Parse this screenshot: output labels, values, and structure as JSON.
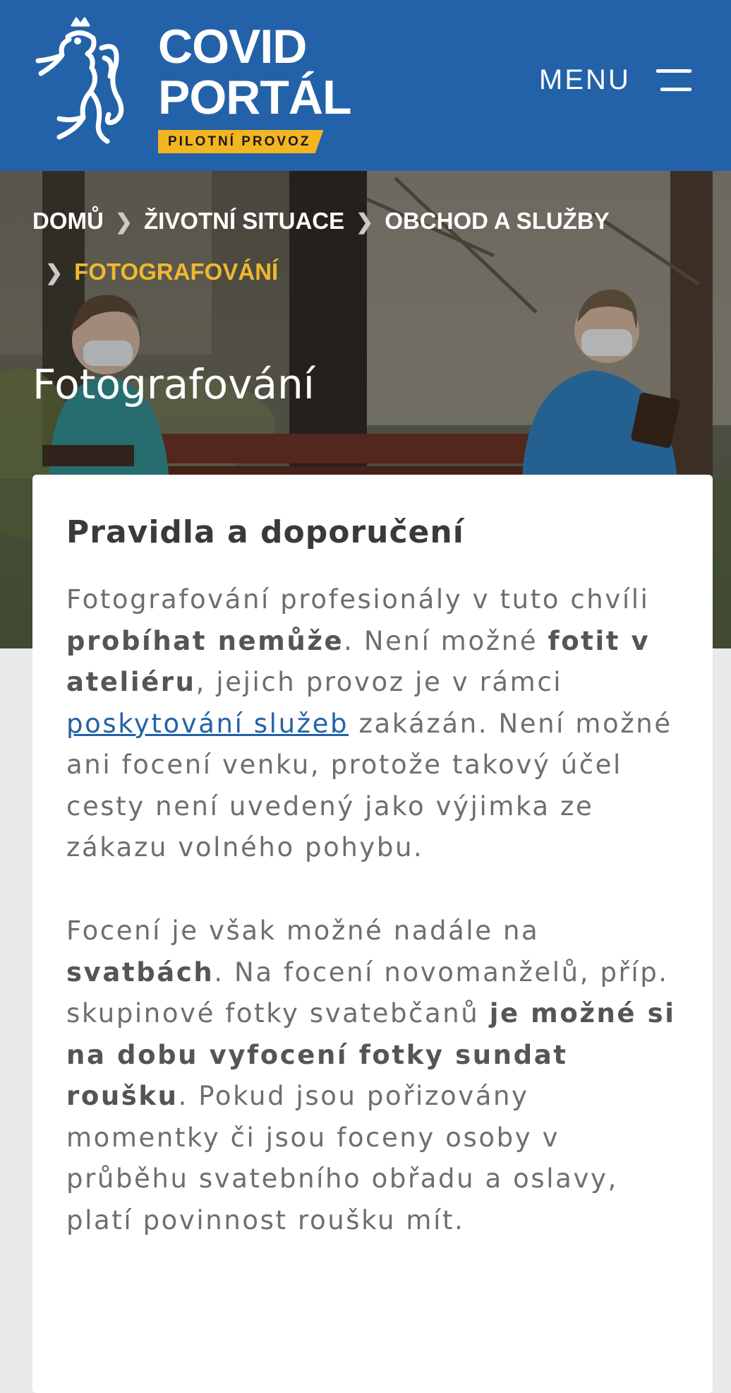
{
  "header": {
    "brand_line1": "COVID",
    "brand_line2": "PORTÁL",
    "badge": "PILOTNÍ PROVOZ",
    "menu_label": "MENU",
    "menu_icon": "hamburger-icon",
    "logo_icon": "czech-lion-emblem",
    "bg_color": "#2362a8",
    "badge_color": "#f3b520"
  },
  "breadcrumb": {
    "items": [
      "DOMŮ",
      "ŽIVOTNÍ SITUACE",
      "OBCHOD A SLUŽBY"
    ],
    "current": "FOTOGRAFOVÁNÍ",
    "separator_icon": "chevron-right-icon",
    "current_color": "#f0b82e"
  },
  "page": {
    "title": "Fotografování"
  },
  "card": {
    "heading": "Pravidla a doporučení",
    "p1": {
      "t1": "Fotografování profesionály v tuto chvíli ",
      "b1": "probíhat nemůže",
      "t2": ". Není možné ",
      "b2": "fotit v ateliéru",
      "t3": ", jejich provoz je v rámci ",
      "link": "poskytování služeb",
      "t4": " zakázán. Není možné ani focení venku, protože takový účel cesty není uvedený jako výjimka ze zákazu volného pohybu."
    },
    "p2": {
      "t1": "Focení je však možné nadále na ",
      "b1": "svatbách",
      "t2": ". Na focení novomanželů, příp. skupinové fotky svatebčanů ",
      "b2": "je možné si na dobu vyfocení fotky sundat roušku",
      "t3": ". Pokud jsou pořizovány momentky či jsou foceny osoby v průběhu svatebního obřadu a oslavy, platí povinnost roušku mít."
    },
    "link_color": "#2362a8"
  }
}
